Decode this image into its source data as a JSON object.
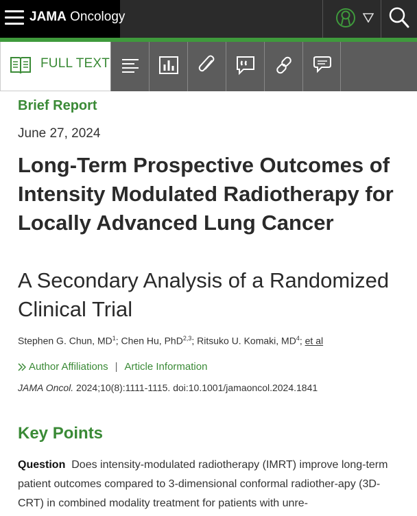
{
  "brand": {
    "name_bold": "JAMA",
    "name_rest": " Oncology"
  },
  "toolbar": {
    "fulltext_label": "FULL TEXT",
    "icons": [
      "outline-icon",
      "figures-icon",
      "attachments-icon",
      "quotes-icon",
      "link-icon",
      "comments-icon"
    ]
  },
  "article": {
    "type": "Brief Report",
    "date": "June 27, 2024",
    "title": "Long-Term Prospective Outcomes of Intensity Modulated Radiotherapy for Locally Advanced Lung Cancer",
    "subtitle": "A Secondary Analysis of a Randomized Clinical Trial",
    "authors": [
      {
        "name": "Stephen G. Chun, MD",
        "sup": "1",
        "after": "; "
      },
      {
        "name": "Chen Hu, PhD",
        "sup": "2,3",
        "after": "; "
      },
      {
        "name": "Ritsuko U. Komaki, MD",
        "sup": "4",
        "after": "; "
      }
    ],
    "et_al": "et al",
    "affiliations_link": "Author Affiliations",
    "separator": "|",
    "article_info_link": "Article Information",
    "citation_journal": "JAMA Oncol.",
    "citation_rest": " 2024;10(8):1111-1115. doi:10.1001/jamaoncol.2024.1841"
  },
  "key_points": {
    "heading": "Key Points",
    "question_label": "Question",
    "question_text": "Does intensity-modulated radiotherapy (IMRT) improve long-term patient outcomes compared to 3-dimensional conformal radiother-apy (3D-CRT) in combined modality treatment for patients with unre-"
  },
  "colors": {
    "accent_green": "#3a8a36",
    "bar_dark": "#2b2b2b",
    "toolbar_gray": "#5c5c5c"
  }
}
